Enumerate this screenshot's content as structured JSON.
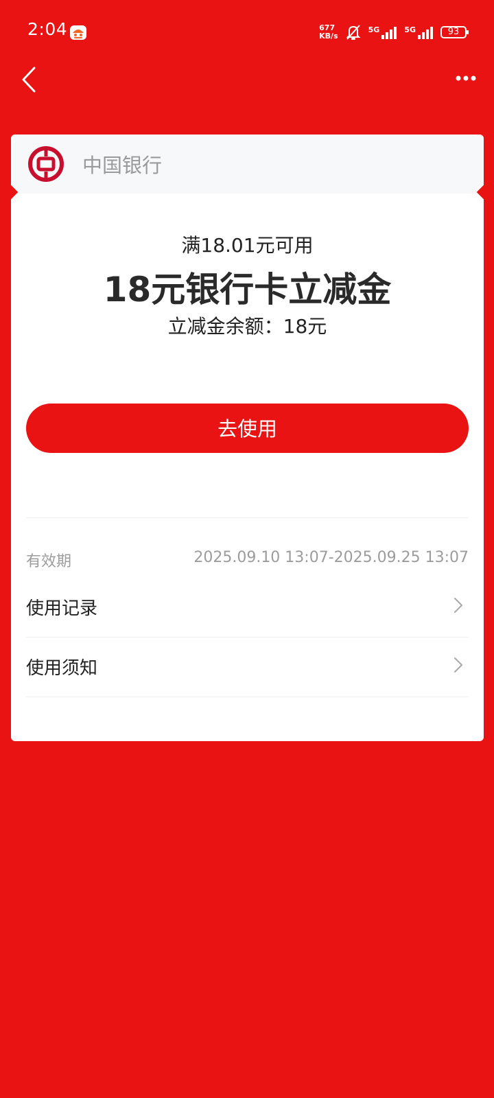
{
  "status_bar": {
    "time": "2:04",
    "net_speed_value": "677",
    "net_speed_unit": "KB/s",
    "signal_1": "5G",
    "signal_2": "5G",
    "battery": "93"
  },
  "icons": {
    "back": "chevron-left-icon",
    "more": "more-horizontal-icon",
    "bank_logo": "bank-of-china-logo",
    "row_chevron": "chevron-right-icon"
  },
  "colors": {
    "background": "#E81312",
    "button": "#E81312",
    "card": "#FFFFFF",
    "header": "#F7F8F9"
  },
  "card": {
    "bank_name": "中国银行",
    "threshold": "满18.01元可用",
    "title": "18元银行卡立减金",
    "balance": "立减金余额：18元",
    "use_button": "去使用",
    "validity_label": "有效期",
    "validity_value": "2025.09.10 13:07-2025.09.25 13:07",
    "rows": [
      {
        "label": "使用记录"
      },
      {
        "label": "使用须知"
      }
    ]
  }
}
